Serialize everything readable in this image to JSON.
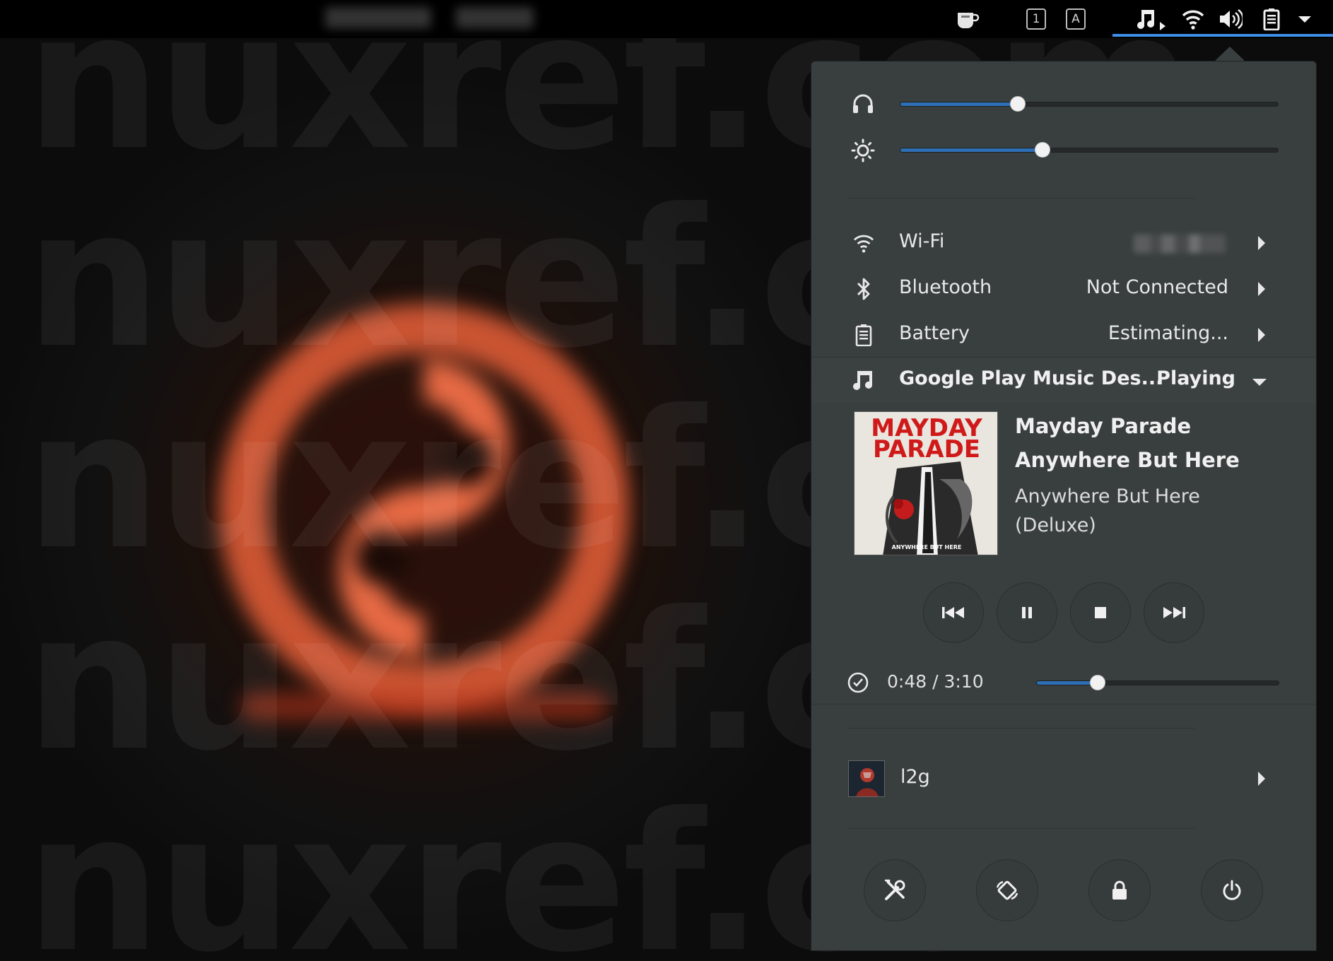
{
  "watermark": {
    "text": "nuxref.com"
  },
  "topbar": {
    "indicators": [
      "caffeine-icon",
      "workspace-indicator",
      "keyboard-layout",
      "music-icon",
      "wifi-icon",
      "volume-icon",
      "battery-icon",
      "dropdown-arrow-icon"
    ],
    "workspace_label": "1",
    "keyboard_label": "A"
  },
  "sliders": {
    "volume": {
      "icon": "headphones-icon",
      "level": 0.31
    },
    "brightness": {
      "icon": "brightness-icon",
      "level": 0.375
    }
  },
  "network": {
    "wifi": {
      "label": "Wi-Fi",
      "status": ""
    },
    "bluetooth": {
      "label": "Bluetooth",
      "status": "Not Connected"
    },
    "battery": {
      "label": "Battery",
      "status": "Estimating..."
    }
  },
  "media": {
    "player_name": "Google Play Music Des...",
    "player_state": "Playing",
    "artist": "Mayday Parade",
    "title": "Anywhere But Here",
    "album": "Anywhere But Here (Deluxe)",
    "album_art_text": [
      "MAYDAY",
      "PARADE",
      "ANYWHERE BUT HERE"
    ],
    "controls": [
      "previous-icon",
      "pause-icon",
      "stop-icon",
      "next-icon"
    ],
    "position_text": "0:48 / 3:10",
    "position_fraction": 0.25
  },
  "user": {
    "name": "l2g"
  },
  "system_buttons": [
    "settings-icon",
    "rotation-lock-icon",
    "lock-icon",
    "power-icon"
  ],
  "colors": {
    "accent": "#3d8ee6",
    "slider_fill": "#2d6eb5",
    "menu_bg": "#393f3f",
    "topbar_bg": "#000000"
  }
}
